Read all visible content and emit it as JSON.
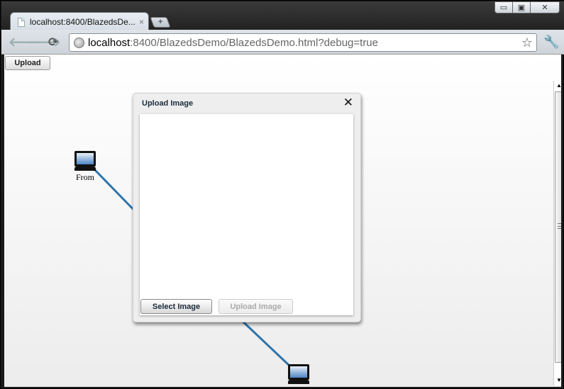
{
  "browser": {
    "tab_title": "localhost:8400/BlazedsDe...",
    "tab_close": "×",
    "new_tab": "+",
    "url_host": "localhost",
    "url_rest": ":8400/BlazedsDemo/BlazedsDemo.html?debug=true",
    "window_controls": {
      "minimize": "▭",
      "maximize": "▣",
      "close": "✕"
    }
  },
  "toolbar": {
    "upload_label": "Upload"
  },
  "diagram": {
    "nodes": [
      {
        "label": "From"
      },
      {
        "label": ""
      }
    ],
    "link_color": "#2f74aa"
  },
  "dialog": {
    "title": "Upload Image",
    "close": "✕",
    "select_label": "Select Image",
    "upload_label": "Upload Image"
  }
}
